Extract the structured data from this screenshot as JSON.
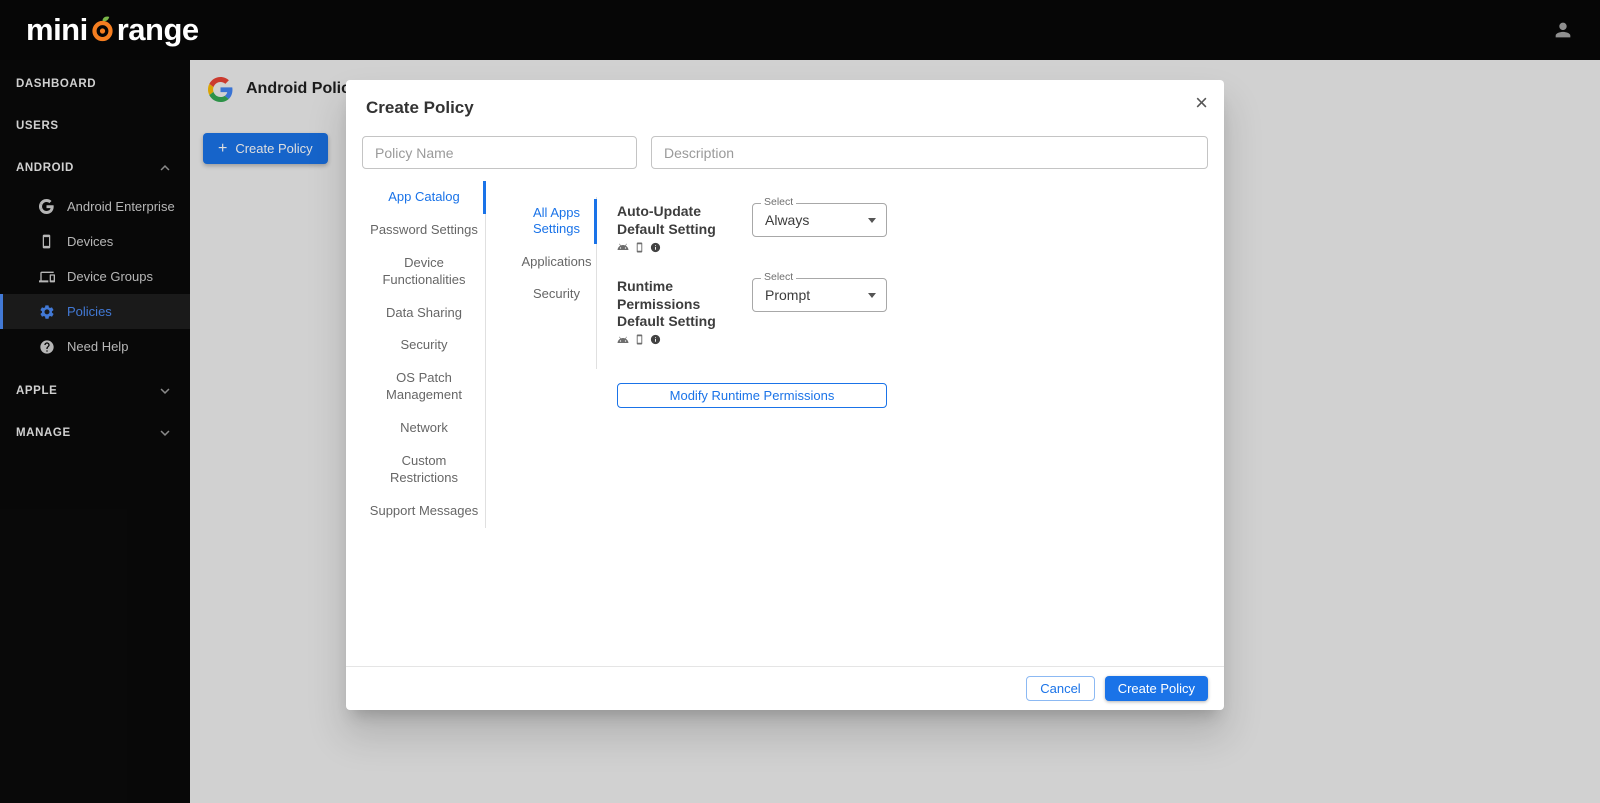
{
  "icons": {
    "plus": "+",
    "close": "×"
  },
  "header": {
    "logo_mini": "mini",
    "logo_range": "range"
  },
  "sidebar": {
    "dashboard": "DASHBOARD",
    "users": "USERS",
    "android": "ANDROID",
    "apple": "APPLE",
    "manage": "MANAGE",
    "android_items": [
      {
        "label": "Android Enterprise"
      },
      {
        "label": "Devices"
      },
      {
        "label": "Device Groups"
      },
      {
        "label": "Policies"
      },
      {
        "label": "Need Help"
      }
    ]
  },
  "page": {
    "title": "Android Polic",
    "create_policy_button": "Create Policy"
  },
  "modal": {
    "title": "Create Policy",
    "policy_name_placeholder": "Policy Name",
    "description_placeholder": "Description",
    "tabs": [
      "App Catalog",
      "Password Settings",
      "Device Functionalities",
      "Data Sharing",
      "Security",
      "OS Patch Management",
      "Network",
      "Custom Restrictions",
      "Support Messages"
    ],
    "active_tab": "App Catalog",
    "subtabs": [
      "All Apps Settings",
      "Applications",
      "Security"
    ],
    "active_subtab": "All Apps Settings",
    "settings": [
      {
        "label": "Auto-Update Default Setting",
        "select_label": "Select",
        "value": "Always"
      },
      {
        "label": "Runtime Permissions Default Setting",
        "select_label": "Select",
        "value": "Prompt"
      }
    ],
    "modify_button": "Modify Runtime Permissions",
    "cancel_button": "Cancel",
    "submit_button": "Create Policy"
  },
  "colors": {
    "accent": "#1a73e8",
    "sidebar_active": "#4c8bf5",
    "header_bg": "#060606",
    "logo_orange": "#f57e20",
    "logo_leaf_green": "#7ab648"
  }
}
